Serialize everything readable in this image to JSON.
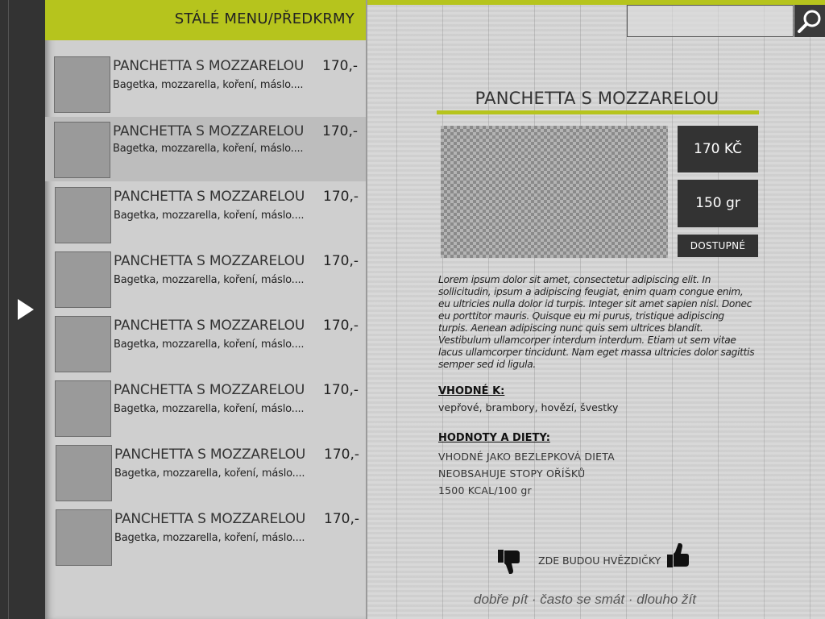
{
  "rail": {
    "toggle_icon": "play-arrow-icon"
  },
  "menu": {
    "title": "STÁLÉ MENU/PŘEDKRMY",
    "items": [
      {
        "name": "PANCHETTA S MOZZARELOU",
        "price": "170,-",
        "desc": "Bagetka, mozzarella, koření, máslo....",
        "selected": false
      },
      {
        "name": "PANCHETTA S MOZZARELOU",
        "price": "170,-",
        "desc": "Bagetka, mozzarella, koření, máslo....",
        "selected": true
      },
      {
        "name": "PANCHETTA S MOZZARELOU",
        "price": "170,-",
        "desc": "Bagetka, mozzarella, koření, máslo....",
        "selected": false
      },
      {
        "name": "PANCHETTA S MOZZARELOU",
        "price": "170,-",
        "desc": "Bagetka, mozzarella, koření, máslo....",
        "selected": false
      },
      {
        "name": "PANCHETTA S MOZZARELOU",
        "price": "170,-",
        "desc": "Bagetka, mozzarella, koření, máslo....",
        "selected": false
      },
      {
        "name": "PANCHETTA S MOZZARELOU",
        "price": "170,-",
        "desc": "Bagetka, mozzarella, koření, máslo....",
        "selected": false
      },
      {
        "name": "PANCHETTA S MOZZARELOU",
        "price": "170,-",
        "desc": "Bagetka, mozzarella, koření, máslo....",
        "selected": false
      },
      {
        "name": "PANCHETTA S MOZZARELOU",
        "price": "170,-",
        "desc": "Bagetka, mozzarella, koření, máslo....",
        "selected": false
      }
    ]
  },
  "detail": {
    "search": {
      "icon": "search-icon",
      "value": ""
    },
    "title": "PANCHETTA S MOZZARELOU",
    "price": "170 KČ",
    "weight": "150 gr",
    "availability": "DOSTUPNÉ",
    "description": "Lorem ipsum dolor sit amet, consectetur adipiscing elit. In sollicitudin, ipsum a adipiscing feugiat, enim quam congue enim, eu ultricies nulla dolor id turpis. Integer sit amet sapien nisl. Donec eu porttitor mauris. Quisque eu mi purus, tristique adipiscing turpis. Aenean adipiscing nunc quis sem ultrices blandit. Vestibulum ullamcorper interdum interdum. Etiam ut sem vitae lacus ullamcorper tincidunt. Nam eget massa ultricies dolor sagittis semper sed id ligula.",
    "suits_heading": "VHODNÉ K:",
    "suits_value": "vepřové, brambory, hovězí, švestky",
    "diet_heading": "HODNOTY A DIETY:",
    "diet_lines": [
      "VHODNÉ JAKO BEZLEPKOVÁ DIETA",
      "NEOBSAHUJE STOPY OŘÍŠKŮ",
      "1500 KCAL/100 gr"
    ],
    "rating_text": "ZDE BUDOU HVĚZDIČKY",
    "thumbs_down_icon": "thumbs-down-icon",
    "thumbs_up_icon": "thumbs-up-icon",
    "footer": "dobře pít · často se smát · dlouho žít"
  },
  "colors": {
    "accent": "#b6c41d",
    "dark": "#333333",
    "panel": "#cfcfcf",
    "selected": "#bdbdbd"
  }
}
